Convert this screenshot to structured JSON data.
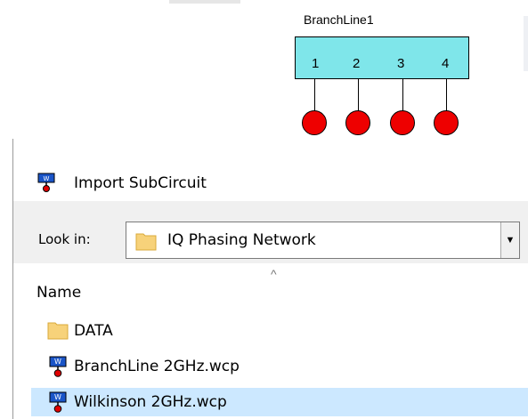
{
  "schematic": {
    "subcircuit_name": "BranchLine1",
    "ports": [
      "1",
      "2",
      "3",
      "4"
    ],
    "box_color": "#7fe6ea",
    "terminal_color": "#ee0000"
  },
  "dialog": {
    "title": "Import SubCircuit",
    "look_in_label": "Look in:",
    "look_in_value": "IQ Phasing Network",
    "column_name": "Name",
    "files": [
      {
        "name": "DATA",
        "icon": "folder-icon",
        "selected": false
      },
      {
        "name": "BranchLine 2GHz.wcp",
        "icon": "wcp-file-icon",
        "selected": false
      },
      {
        "name": "Wilkinson 2GHz.wcp",
        "icon": "wcp-file-icon",
        "selected": true
      }
    ],
    "selection_color": "#cce8ff"
  }
}
